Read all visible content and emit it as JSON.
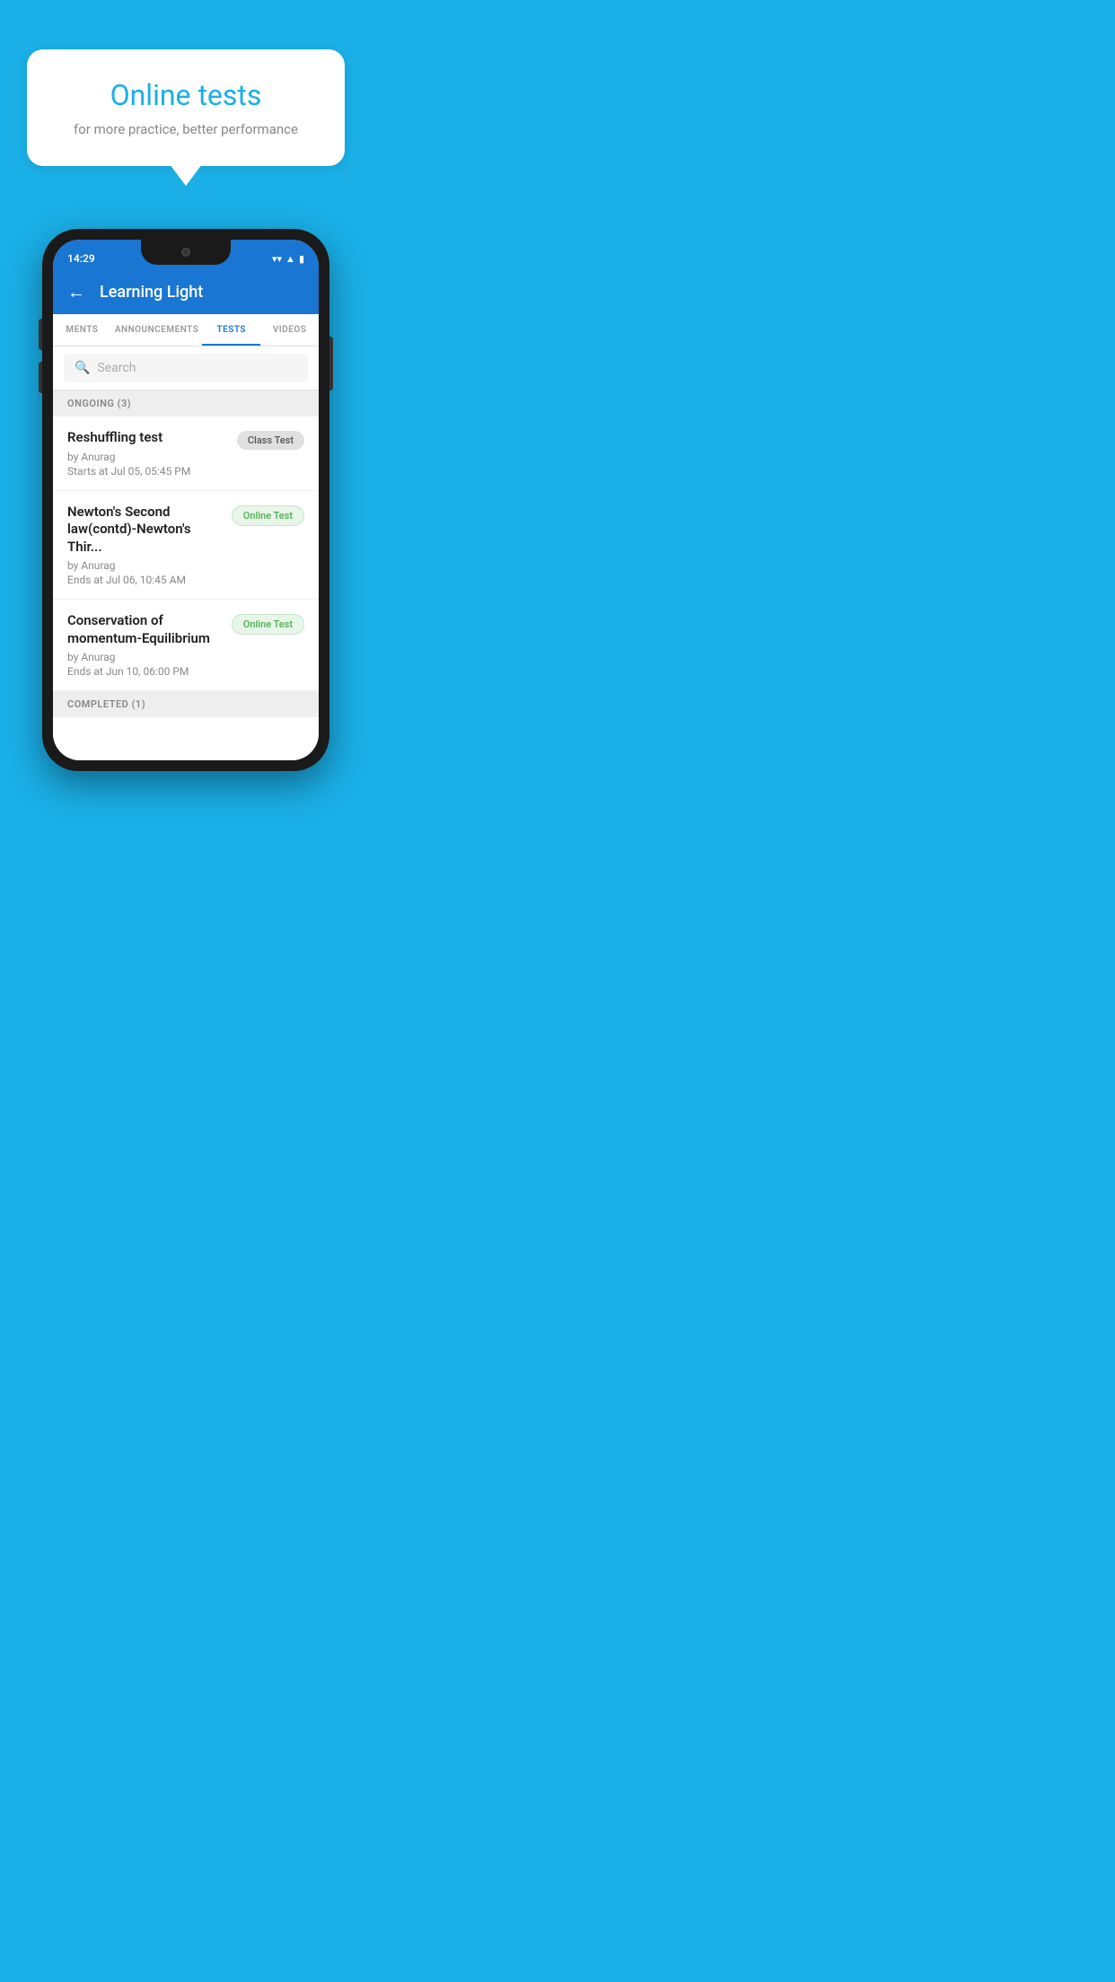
{
  "hero": {
    "bubble_title": "Online tests",
    "bubble_subtitle": "for more practice, better performance"
  },
  "status_bar": {
    "time": "14:29",
    "wifi": "▼",
    "signal": "▲",
    "battery": "▮"
  },
  "app_bar": {
    "title": "Learning Light",
    "back_label": "←"
  },
  "tabs": [
    {
      "label": "MENTS",
      "active": false
    },
    {
      "label": "ANNOUNCEMENTS",
      "active": false
    },
    {
      "label": "TESTS",
      "active": true
    },
    {
      "label": "VIDEOS",
      "active": false
    }
  ],
  "search": {
    "placeholder": "Search"
  },
  "section_ongoing": {
    "label": "ONGOING (3)"
  },
  "tests": [
    {
      "name": "Reshuffling test",
      "author": "by Anurag",
      "date_label": "Starts at",
      "date": "Jul 05, 05:45 PM",
      "badge": "Class Test",
      "badge_type": "class"
    },
    {
      "name": "Newton's Second law(contd)-Newton's Thir...",
      "author": "by Anurag",
      "date_label": "Ends at",
      "date": "Jul 06, 10:45 AM",
      "badge": "Online Test",
      "badge_type": "online"
    },
    {
      "name": "Conservation of momentum-Equilibrium",
      "author": "by Anurag",
      "date_label": "Ends at",
      "date": "Jun 10, 06:00 PM",
      "badge": "Online Test",
      "badge_type": "online"
    }
  ],
  "section_completed": {
    "label": "COMPLETED (1)"
  }
}
